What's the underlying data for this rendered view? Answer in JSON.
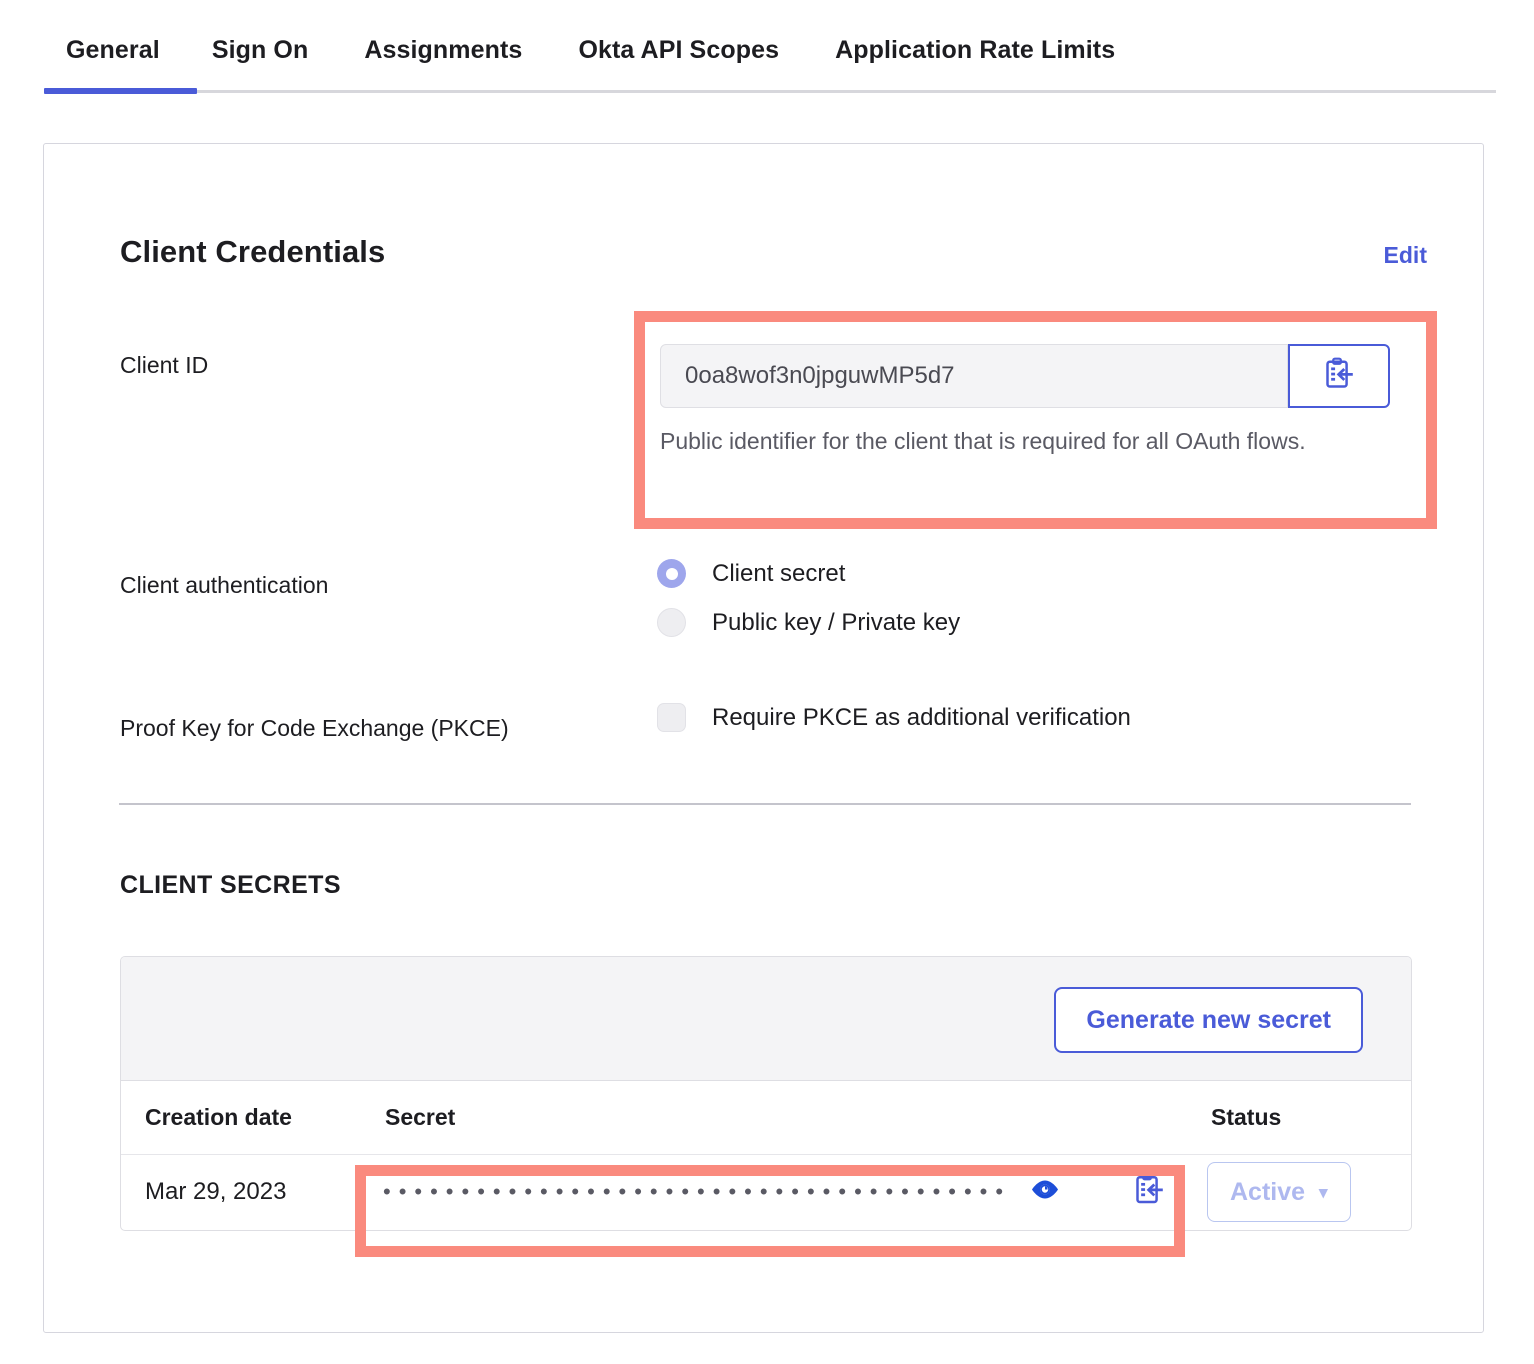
{
  "tabs": [
    {
      "label": "General",
      "active": true
    },
    {
      "label": "Sign On",
      "active": false
    },
    {
      "label": "Assignments",
      "active": false
    },
    {
      "label": "Okta API Scopes",
      "active": false
    },
    {
      "label": "Application Rate Limits",
      "active": false
    }
  ],
  "card": {
    "section_title": "Client Credentials",
    "edit_label": "Edit",
    "client_id": {
      "label": "Client ID",
      "value": "0oa8wof3n0jpguwMP5d7",
      "hint": "Public identifier for the client that is required for all OAuth flows.",
      "copy_icon": "clipboard-copy-icon"
    },
    "client_authentication": {
      "label": "Client authentication",
      "options": [
        {
          "label": "Client secret",
          "selected": true
        },
        {
          "label": "Public key / Private key",
          "selected": false
        }
      ]
    },
    "pkce": {
      "label": "Proof Key for Code Exchange (PKCE)",
      "option": {
        "label": "Require PKCE as additional verification",
        "checked": false
      }
    },
    "client_secrets": {
      "title": "CLIENT SECRETS",
      "generate_button": "Generate new secret",
      "columns": [
        "Creation date",
        "Secret",
        "Status"
      ],
      "rows": [
        {
          "creation_date": "Mar 29, 2023",
          "secret_masked": "••••••••••••••••••••••••••••••••••••••••",
          "reveal_icon": "eye-icon",
          "copy_icon": "clipboard-copy-icon",
          "status": "Active",
          "status_caret": "▾"
        }
      ]
    }
  },
  "annotations": {
    "highlight_color": "#fa8a7e",
    "boxes": [
      "client-id-field",
      "secret-value-cell"
    ]
  },
  "colors": {
    "accent_blue": "#4a5bd8",
    "radio_selected": "#9ea6ec",
    "status_disabled_text": "#aeb8ef",
    "highlight_red": "#fa8a7e"
  }
}
